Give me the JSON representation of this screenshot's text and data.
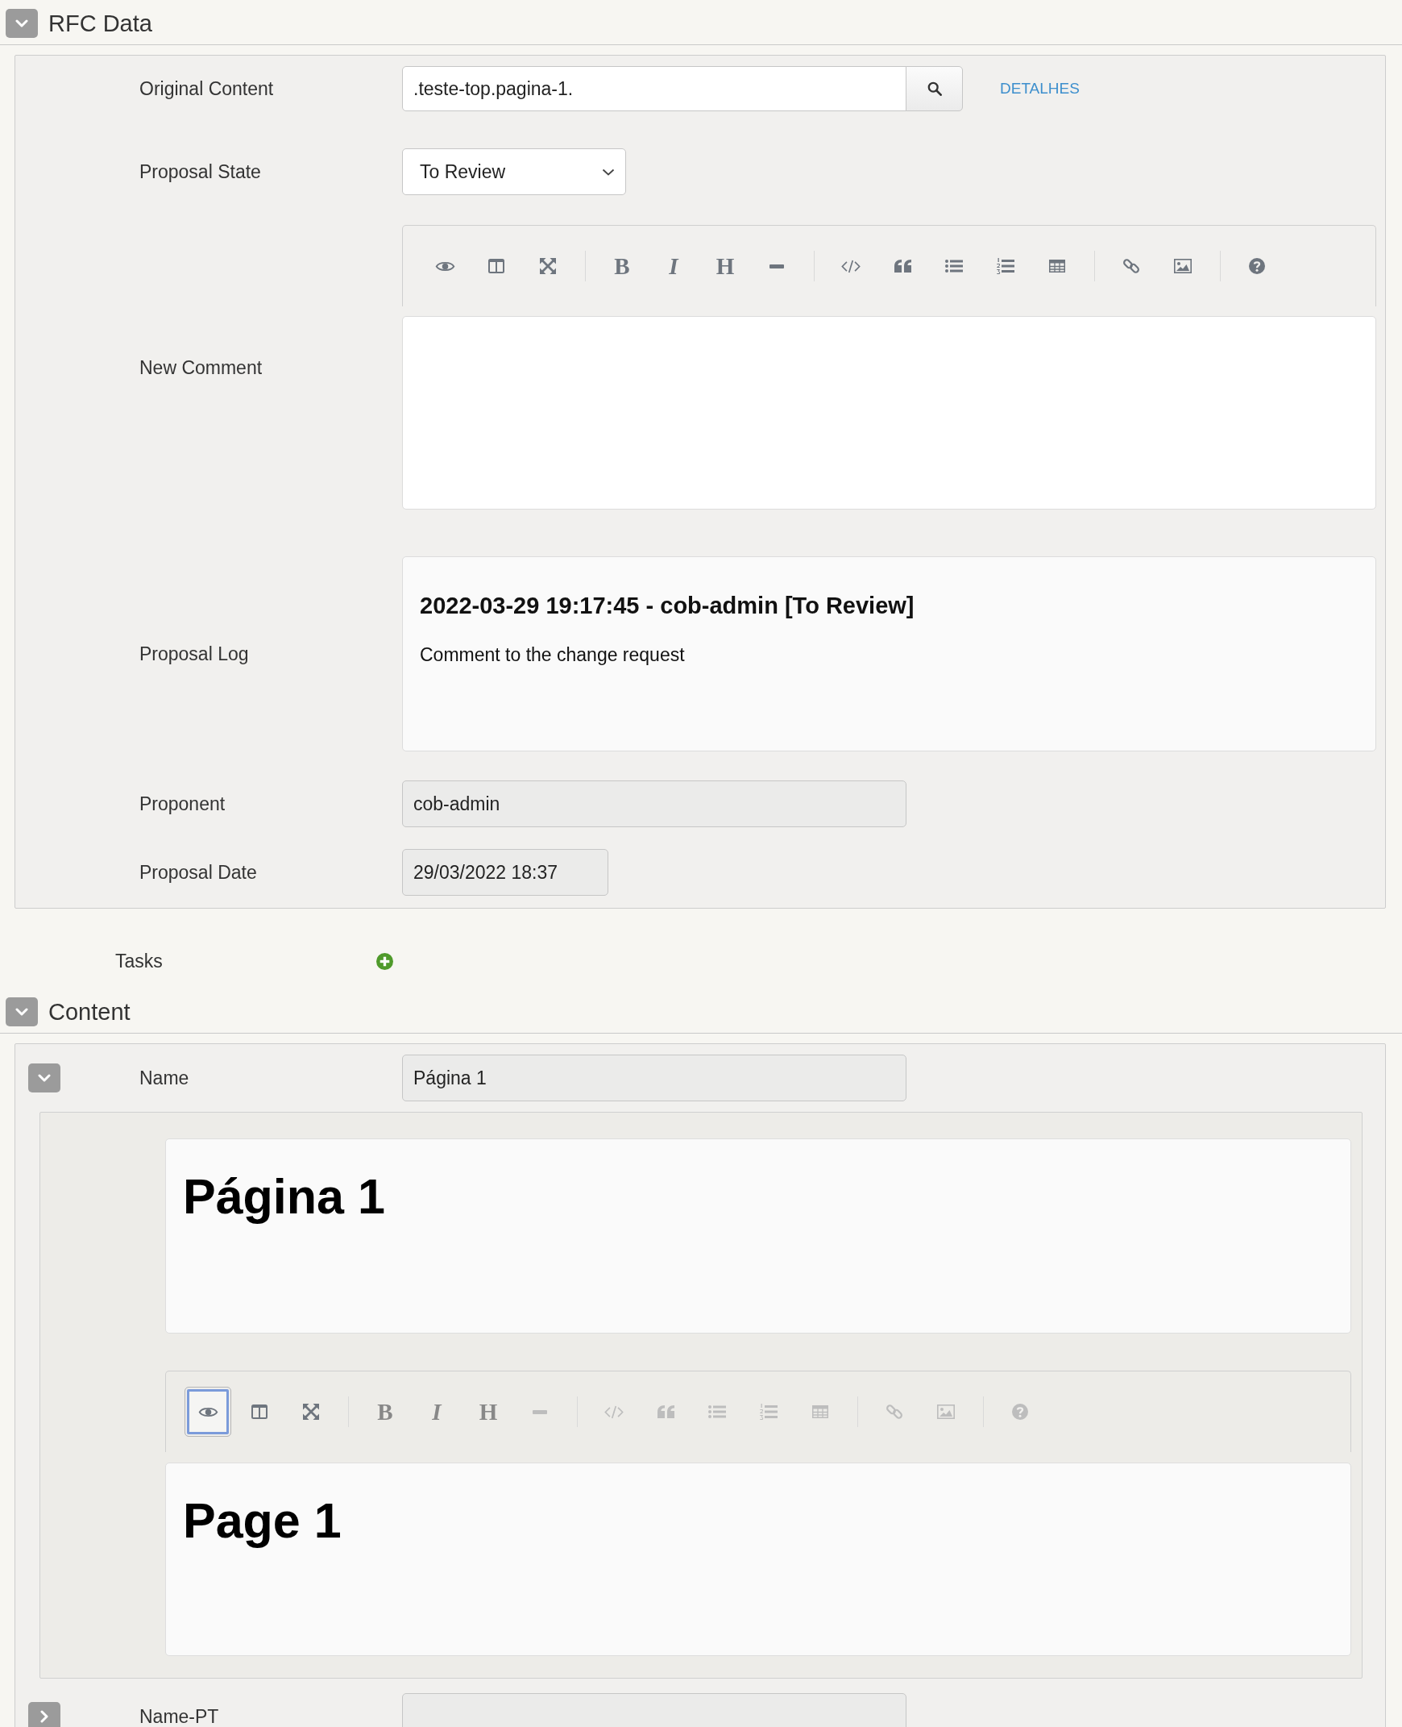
{
  "rfc_data": {
    "title": "RFC Data",
    "expanded": true,
    "fields": [
      {
        "kind": "lookup",
        "label": "Original Content",
        "value": ".teste-top.pagina-1.",
        "link": "DETALHES"
      },
      {
        "kind": "select",
        "label": "Proposal State",
        "value": "To Review"
      },
      {
        "kind": "editor",
        "label": "New Comment",
        "preview": false,
        "toolbar": [
          [
            {
              "disabled": false
            },
            {
              "disabled": false
            },
            {
              "disabled": false
            }
          ],
          [
            {
              "glyph": "B",
              "disabled": false
            },
            {
              "glyph": "I",
              "disabled": false
            },
            {
              "glyph": "H",
              "disabled": false
            },
            {
              "disabled": false
            }
          ],
          [
            {
              "disabled": false
            },
            {
              "disabled": false
            },
            {
              "disabled": false
            },
            {
              "disabled": false
            },
            {
              "disabled": false
            }
          ],
          [
            {
              "disabled": false
            },
            {
              "disabled": false
            }
          ],
          [
            {
              "disabled": false
            }
          ]
        ]
      },
      {
        "kind": "log",
        "label": "Proposal Log",
        "entries": [
          {
            "heading": "2022-03-29 19:17:45 - cob-admin [To Review]",
            "comment": "Comment to the change request"
          }
        ]
      },
      {
        "kind": "text",
        "label": "Proponent",
        "value": "cob-admin",
        "disabled": true
      },
      {
        "kind": "date",
        "label": "Proposal Date",
        "value": "29/03/2022 18:37",
        "disabled": true
      }
    ]
  },
  "tasks": {
    "label": "Tasks"
  },
  "content": {
    "title": "Content",
    "expanded": true,
    "fields": [
      {
        "kind": "text",
        "label": "Name",
        "value": "Página 1",
        "disabled": true,
        "expanded": true,
        "details": [
          {
            "kind": "preview",
            "heading": "Página 1"
          },
          {
            "kind": "editor",
            "preview": true,
            "heading": "Page 1",
            "toolbar": [
              [
                {
                  "disabled": false
                },
                {
                  "disabled": false
                },
                {
                  "disabled": false
                }
              ],
              [
                {
                  "glyph": "B",
                  "disabled": true
                },
                {
                  "glyph": "I",
                  "disabled": true
                },
                {
                  "glyph": "H",
                  "disabled": true
                },
                {
                  "disabled": true
                }
              ],
              [
                {
                  "disabled": true
                },
                {
                  "disabled": true
                },
                {
                  "disabled": true
                },
                {
                  "disabled": true
                },
                {
                  "disabled": true
                }
              ],
              [
                {
                  "disabled": true
                },
                {
                  "disabled": true
                }
              ],
              [
                {
                  "disabled": true
                }
              ]
            ]
          }
        ]
      },
      {
        "kind": "text",
        "label": "Name-PT",
        "disabled": true,
        "expanded": false
      }
    ]
  }
}
